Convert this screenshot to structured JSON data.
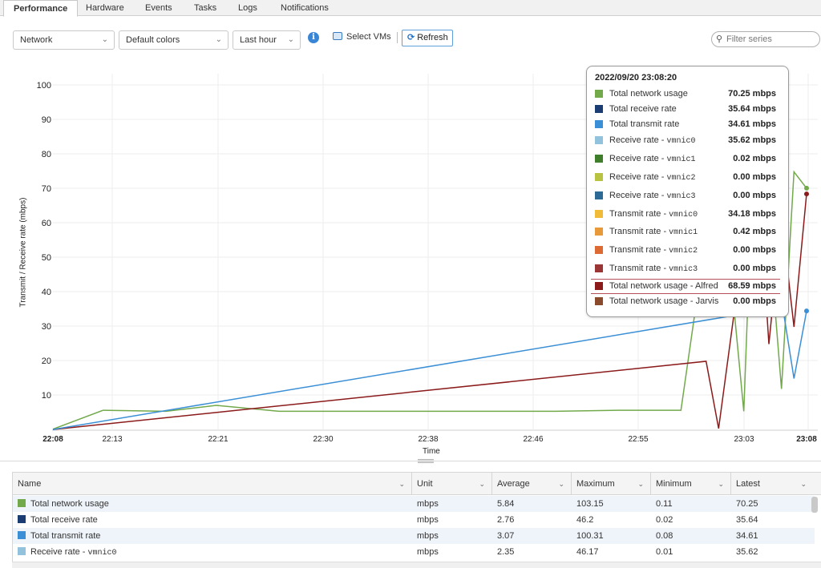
{
  "tabs": [
    "Performance",
    "Hardware",
    "Events",
    "Tasks",
    "Logs",
    "Notifications"
  ],
  "toolbar": {
    "metric_select": "Network",
    "color_select": "Default colors",
    "range_select": "Last hour",
    "select_vms_label": "Select VMs",
    "refresh_label": "Refresh",
    "filter_placeholder": "Filter series"
  },
  "chart": {
    "ylabel": "Transmit / Receive rate (mbps)",
    "xlabel": "Time",
    "x_ticks": [
      "22:08",
      "22:13",
      "22:21",
      "22:30",
      "22:38",
      "22:46",
      "22:55",
      "23:03",
      "23:08"
    ],
    "y_ticks": [
      "10",
      "20",
      "30",
      "40",
      "50",
      "60",
      "70",
      "80",
      "90",
      "100"
    ]
  },
  "chart_data": {
    "type": "line",
    "xlabel": "Time",
    "ylabel": "Transmit / Receive rate (mbps)",
    "ylim": [
      0,
      105
    ],
    "x_ticks": [
      "22:08",
      "22:13",
      "22:21",
      "22:30",
      "22:38",
      "22:46",
      "22:55",
      "23:03",
      "23:08"
    ],
    "grid": true,
    "series": [
      {
        "name": "Total network usage",
        "color": "#71a94b",
        "points": [
          [
            "22:08",
            0.3
          ],
          [
            "22:12",
            5.8
          ],
          [
            "22:17",
            5.5
          ],
          [
            "22:21",
            7.2
          ],
          [
            "22:26",
            5.5
          ],
          [
            "22:31",
            5.5
          ],
          [
            "22:37",
            5.5
          ],
          [
            "22:43",
            5.5
          ],
          [
            "22:48",
            5.5
          ],
          [
            "22:53",
            5.8
          ],
          [
            "22:58",
            5.8
          ],
          [
            "23:01",
            82
          ],
          [
            "23:03",
            5.5
          ],
          [
            "23:04",
            103
          ],
          [
            "23:06",
            12
          ],
          [
            "23:07",
            75
          ],
          [
            "23:08",
            70.25
          ]
        ]
      },
      {
        "name": "Total network usage - Alfred",
        "color": "#8b1a1a",
        "points": [
          [
            "22:08",
            0.2
          ],
          [
            "23:00",
            20
          ],
          [
            "23:01",
            0.5
          ],
          [
            "23:04",
            82
          ],
          [
            "23:05",
            25
          ],
          [
            "23:06",
            62
          ],
          [
            "23:07",
            30
          ],
          [
            "23:08",
            68.59
          ]
        ]
      },
      {
        "name": "Total transmit rate",
        "color": "#3a8fd6",
        "points": [
          [
            "22:08",
            0.2
          ],
          [
            "23:05",
            35
          ],
          [
            "23:06",
            38
          ],
          [
            "23:07",
            15
          ],
          [
            "23:08",
            34.61
          ]
        ]
      }
    ]
  },
  "tooltip": {
    "title": "2022/09/20 23:08:20",
    "rows": [
      {
        "name": "Total network usage",
        "mono": "",
        "value": "70.25 mbps",
        "color": "#71a94b"
      },
      {
        "name": "Total receive rate",
        "mono": "",
        "value": "35.64 mbps",
        "color": "#1c3d74"
      },
      {
        "name": "Total transmit rate",
        "mono": "",
        "value": "34.61 mbps",
        "color": "#3a8fd6"
      },
      {
        "name": "Receive rate - ",
        "mono": "vmnic0",
        "value": "35.62 mbps",
        "color": "#92c2dc"
      },
      {
        "name": "Receive rate - ",
        "mono": "vmnic1",
        "value": "0.02 mbps",
        "color": "#3f7f2b"
      },
      {
        "name": "Receive rate - ",
        "mono": "vmnic2",
        "value": "0.00 mbps",
        "color": "#b8c441"
      },
      {
        "name": "Receive rate - ",
        "mono": "vmnic3",
        "value": "0.00 mbps",
        "color": "#2d6a95"
      },
      {
        "name": "Transmit rate - ",
        "mono": "vmnic0",
        "value": "34.18 mbps",
        "color": "#f0bb39"
      },
      {
        "name": "Transmit rate - ",
        "mono": "vmnic1",
        "value": "0.42 mbps",
        "color": "#e89a3a"
      },
      {
        "name": "Transmit rate - ",
        "mono": "vmnic2",
        "value": "0.00 mbps",
        "color": "#dc6a32"
      },
      {
        "name": "Transmit rate - ",
        "mono": "vmnic3",
        "value": "0.00 mbps",
        "color": "#9a3636"
      },
      {
        "name": "Total network usage - Alfred",
        "mono": "",
        "value": "68.59 mbps",
        "color": "#8b1a1a"
      },
      {
        "name": "Total network usage - Jarvis",
        "mono": "",
        "value": "0.00 mbps",
        "color": "#8a4a2c"
      }
    ]
  },
  "table": {
    "columns": [
      "Name",
      "Unit",
      "Average",
      "Maximum",
      "Minimum",
      "Latest"
    ],
    "rows": [
      {
        "name": "Total network usage",
        "mono": "",
        "color": "#71a94b",
        "unit": "mbps",
        "average": "5.84",
        "maximum": "103.15",
        "minimum": "0.11",
        "latest": "70.25"
      },
      {
        "name": "Total receive rate",
        "mono": "",
        "color": "#1c3d74",
        "unit": "mbps",
        "average": "2.76",
        "maximum": "46.2",
        "minimum": "0.02",
        "latest": "35.64"
      },
      {
        "name": "Total transmit rate",
        "mono": "",
        "color": "#3a8fd6",
        "unit": "mbps",
        "average": "3.07",
        "maximum": "100.31",
        "minimum": "0.08",
        "latest": "34.61"
      },
      {
        "name": "Receive rate - ",
        "mono": "vmnic0",
        "color": "#92c2dc",
        "unit": "mbps",
        "average": "2.35",
        "maximum": "46.17",
        "minimum": "0.01",
        "latest": "35.62"
      }
    ]
  }
}
